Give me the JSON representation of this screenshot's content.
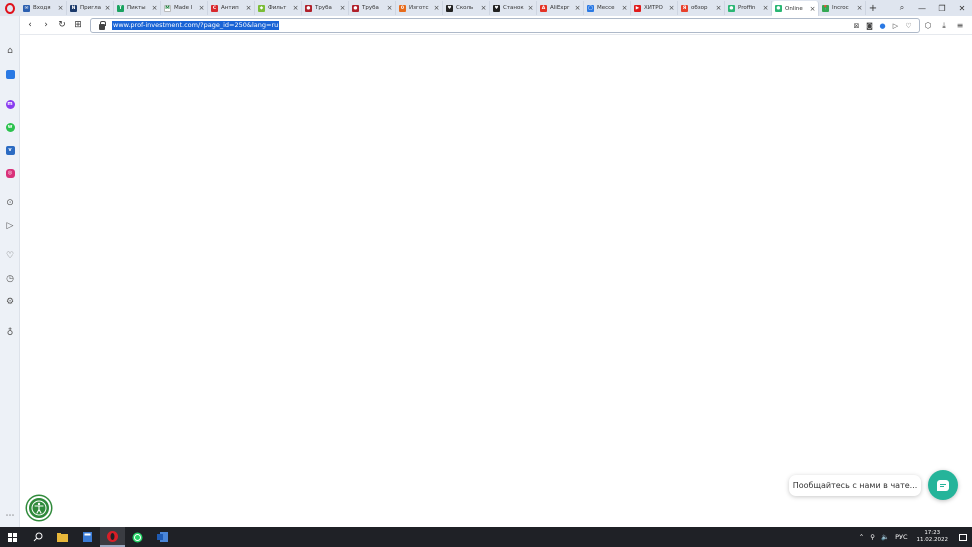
{
  "browser": {
    "tabs": [
      {
        "title": "Входя",
        "color": "#2b5fb0",
        "glyph": "✉",
        "active": false
      },
      {
        "title": "Пригла",
        "color": "#1b3a6b",
        "glyph": "N",
        "active": false
      },
      {
        "title": "Пикты",
        "color": "#1aa260",
        "glyph": "T",
        "active": false
      },
      {
        "title": "Made I",
        "color": "#ffffff",
        "glyph": "M",
        "active": false
      },
      {
        "title": "Антип",
        "color": "#d8282d",
        "glyph": "C",
        "active": false
      },
      {
        "title": "Фильт",
        "color": "#7bbd37",
        "glyph": "◆",
        "active": false
      },
      {
        "title": "Труба",
        "color": "#b0202a",
        "glyph": "●",
        "active": false
      },
      {
        "title": "Труба",
        "color": "#b0202a",
        "glyph": "●",
        "active": false
      },
      {
        "title": "Изготс",
        "color": "#e76b1c",
        "glyph": "0",
        "active": false
      },
      {
        "title": "Сколь",
        "color": "#222222",
        "glyph": "♥",
        "active": false
      },
      {
        "title": "Станок",
        "color": "#222222",
        "glyph": "♥",
        "active": false
      },
      {
        "title": "AliExpr",
        "color": "#e43225",
        "glyph": "A",
        "active": false
      },
      {
        "title": "Мессе",
        "color": "#2a79e4",
        "glyph": "◯",
        "active": false
      },
      {
        "title": "ХИТРО",
        "color": "#e01b1b",
        "glyph": "▶",
        "active": false
      },
      {
        "title": "обзор",
        "color": "#e8402b",
        "glyph": "Я",
        "active": false
      },
      {
        "title": "Proffin",
        "color": "#2bb673",
        "glyph": "●",
        "active": false
      },
      {
        "title": "Online",
        "color": "#2bb673",
        "glyph": "●",
        "active": true
      },
      {
        "title": "Incroc",
        "color": "#34a853",
        "glyph": "📍",
        "active": false
      }
    ],
    "new_tab_label": "+",
    "url": "www.prof-investment.com/?page_id=250&lang=ru"
  },
  "chat": {
    "bubble_text": "Пообщайтесь с нами в чате..."
  },
  "taskbar": {
    "language": "РУС",
    "time": "17:23",
    "date": "11.02.2022"
  }
}
